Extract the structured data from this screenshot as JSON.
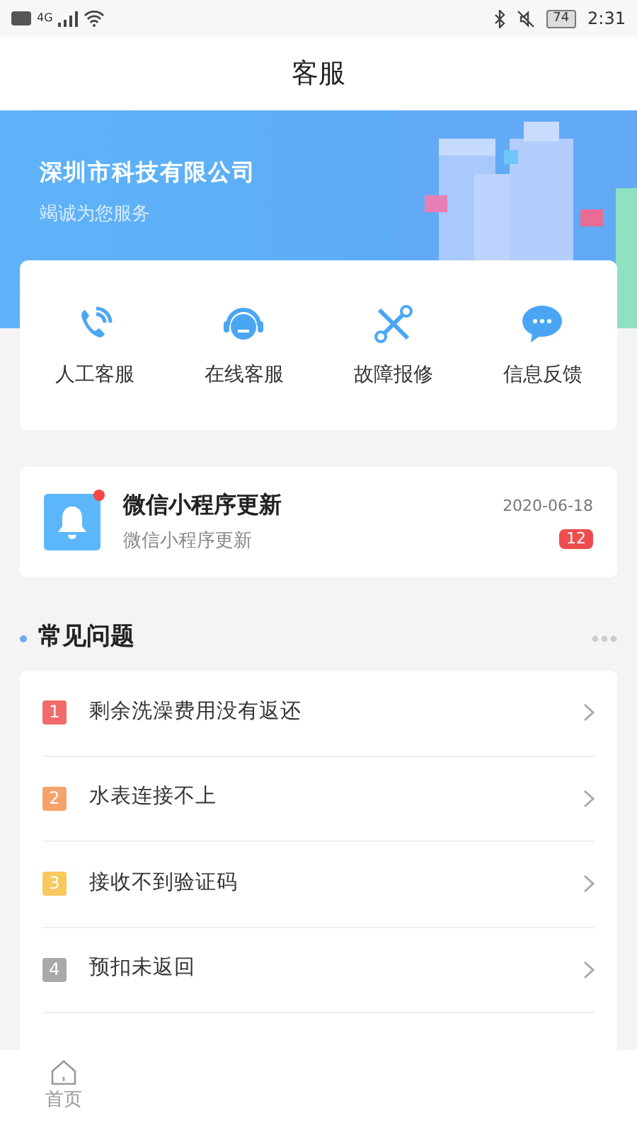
{
  "status_bar": {
    "network": "4G",
    "battery": "74",
    "time": "2:31"
  },
  "header": {
    "title": "客服"
  },
  "banner": {
    "company": "深圳市科技有限公司",
    "slogan": "竭诚为您服务"
  },
  "services": [
    {
      "kind": "phone",
      "label": "人工客服"
    },
    {
      "kind": "headset",
      "label": "在线客服"
    },
    {
      "kind": "tools",
      "label": "故障报修"
    },
    {
      "kind": "chat",
      "label": "信息反馈"
    }
  ],
  "notice": {
    "title": "微信小程序更新",
    "subtitle": "微信小程序更新",
    "date": "2020-06-18",
    "unread_count": "12",
    "has_dot": true
  },
  "faq": {
    "title": "常见问题",
    "items": [
      {
        "number": "1",
        "color": "#f26b6b",
        "text": "剩余洗澡费用没有返还"
      },
      {
        "number": "2",
        "color": "#f5a36b",
        "text": "水表连接不上"
      },
      {
        "number": "3",
        "color": "#f7c95c",
        "text": "接收不到验证码"
      },
      {
        "number": "4",
        "color": "#a9a9a9",
        "text": "预扣未返回"
      }
    ]
  },
  "tab_bar": [
    {
      "label": "首页",
      "selected": false
    }
  ]
}
